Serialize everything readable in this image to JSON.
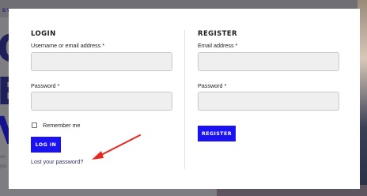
{
  "backdrop": {
    "tag": "BY",
    "big_lines": [
      "O",
      "E",
      "V"
    ],
    "small_lines": [
      "oo",
      "yle"
    ]
  },
  "login": {
    "heading": "LOGIN",
    "username_label": "Username or email address",
    "password_label": "Password",
    "required_mark": "*",
    "remember_label": "Remember me",
    "submit_label": "LOG IN",
    "lost_password_link": "Lost your password?"
  },
  "register": {
    "heading": "REGISTER",
    "email_label": "Email address",
    "password_label": "Password",
    "required_mark": "*",
    "submit_label": "REGISTER"
  },
  "colors": {
    "accent": "#1a12f2",
    "annotation_arrow": "#e8261c",
    "field_bg": "#efefef"
  },
  "icons": {
    "annotation": "arrow-icon"
  }
}
